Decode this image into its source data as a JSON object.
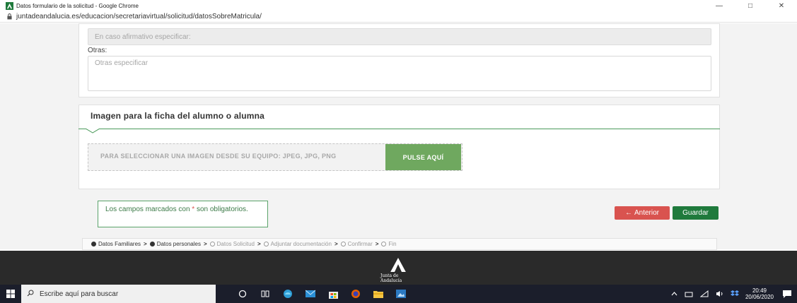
{
  "window": {
    "title": "Datos formulario de la solicitud - Google Chrome",
    "url": "juntadeandalucia.es/educacion/secretariavirtual/solicitud/datosSobreMatricula/",
    "minimize": "—",
    "maximize": "□",
    "close": "✕"
  },
  "form": {
    "specify_placeholder": "En caso afirmativo especificar:",
    "otras_label": "Otras:",
    "otras_placeholder": "Otras especificar"
  },
  "image_section": {
    "title": "Imagen para la ficha del alumno o alumna",
    "dropzone_text": "PARA SELECCIONAR UNA IMAGEN DESDE SU EQUIPO: JPEG, JPG, PNG",
    "upload_button": "PULSE AQUÍ"
  },
  "notice": {
    "before": "Los campos marcados con ",
    "asterisk": "*",
    "after": " son obligatorios."
  },
  "buttons": {
    "prev": "Anterior",
    "prev_icon": "←",
    "save": "Guardar"
  },
  "steps": [
    {
      "label": "Datos Familiares",
      "done": true
    },
    {
      "label": "Datos personales",
      "done": true
    },
    {
      "label": "Datos Solicitud",
      "done": false
    },
    {
      "label": "Adjuntar documentación",
      "done": false
    },
    {
      "label": "Confirmar",
      "done": false
    },
    {
      "label": "Fin",
      "done": false
    }
  ],
  "footer": {
    "logo_text": "Junta de Andalucía"
  },
  "taskbar": {
    "search_placeholder": "Escribe aquí para buscar",
    "time": "20:49",
    "date": "20/06/2020"
  },
  "colors": {
    "brand_green": "#1f7a3c",
    "button_green": "#6fa85f",
    "danger_red": "#d9534f"
  }
}
